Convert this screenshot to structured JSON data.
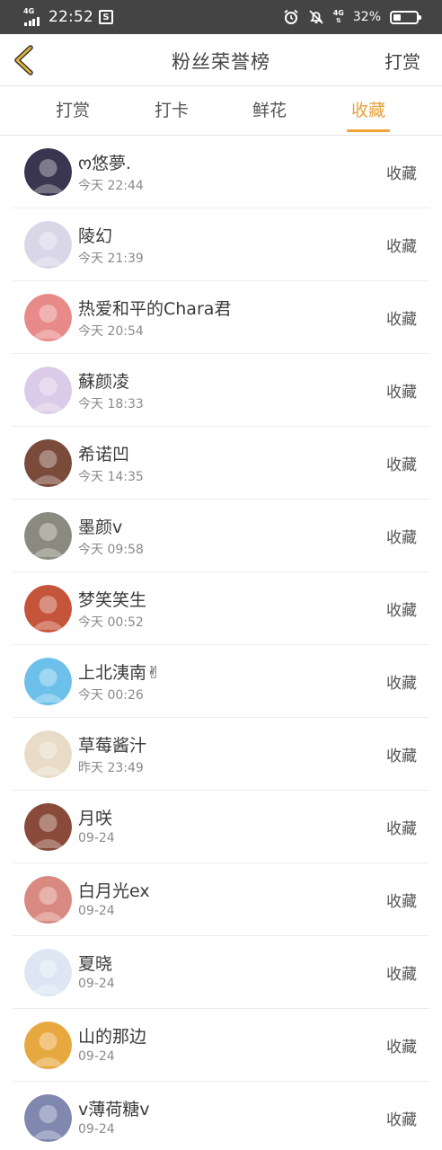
{
  "status_bar": {
    "network_left": "4G",
    "time": "22:52",
    "app_icon_letter": "S",
    "network_right": "4G",
    "battery_percent_text": "32%",
    "battery_level": 0.32
  },
  "header": {
    "title": "粉丝荣誉榜",
    "action_label": "打赏"
  },
  "tabs": [
    {
      "label": "打赏",
      "active": false
    },
    {
      "label": "打卡",
      "active": false
    },
    {
      "label": "鲜花",
      "active": false
    },
    {
      "label": "收藏",
      "active": true
    }
  ],
  "accent_color": "#f0a43a",
  "fans": [
    {
      "name": "ო悠夢.",
      "time": "今天 22:44",
      "action": "收藏",
      "avatar_color": "#3a3550"
    },
    {
      "name": "陵幻",
      "time": "今天 21:39",
      "action": "收藏",
      "avatar_color": "#d9d6e8"
    },
    {
      "name": "热爱和平的Chara君",
      "time": "今天 20:54",
      "action": "收藏",
      "avatar_color": "#e88a8a"
    },
    {
      "name": "蘇颜凌",
      "time": "今天 18:33",
      "action": "收藏",
      "avatar_color": "#dccbe8"
    },
    {
      "name": "希诺凹",
      "time": "今天 14:35",
      "action": "收藏",
      "avatar_color": "#7a4a3a"
    },
    {
      "name": "墨颜v",
      "time": "今天 09:58",
      "action": "收藏",
      "avatar_color": "#8a8a80"
    },
    {
      "name": "梦笑笑生",
      "time": "今天 00:52",
      "action": "收藏",
      "avatar_color": "#c4553a"
    },
    {
      "name": "上北洟南✌",
      "time": "今天 00:26",
      "action": "收藏",
      "avatar_color": "#6cc0ea"
    },
    {
      "name": "草莓酱汁",
      "time": "昨天 23:49",
      "action": "收藏",
      "avatar_color": "#e8dcc8"
    },
    {
      "name": "月咲",
      "time": "09-24",
      "action": "收藏",
      "avatar_color": "#8a4a3a"
    },
    {
      "name": "白月光ex",
      "time": "09-24",
      "action": "收藏",
      "avatar_color": "#d98a80"
    },
    {
      "name": "夏晓",
      "time": "09-24",
      "action": "收藏",
      "avatar_color": "#dde6f2"
    },
    {
      "name": "山的那边",
      "time": "09-24",
      "action": "收藏",
      "avatar_color": "#e8a840"
    },
    {
      "name": "v薄荷糖v",
      "time": "09-24",
      "action": "收藏",
      "avatar_color": "#8088b0"
    }
  ]
}
